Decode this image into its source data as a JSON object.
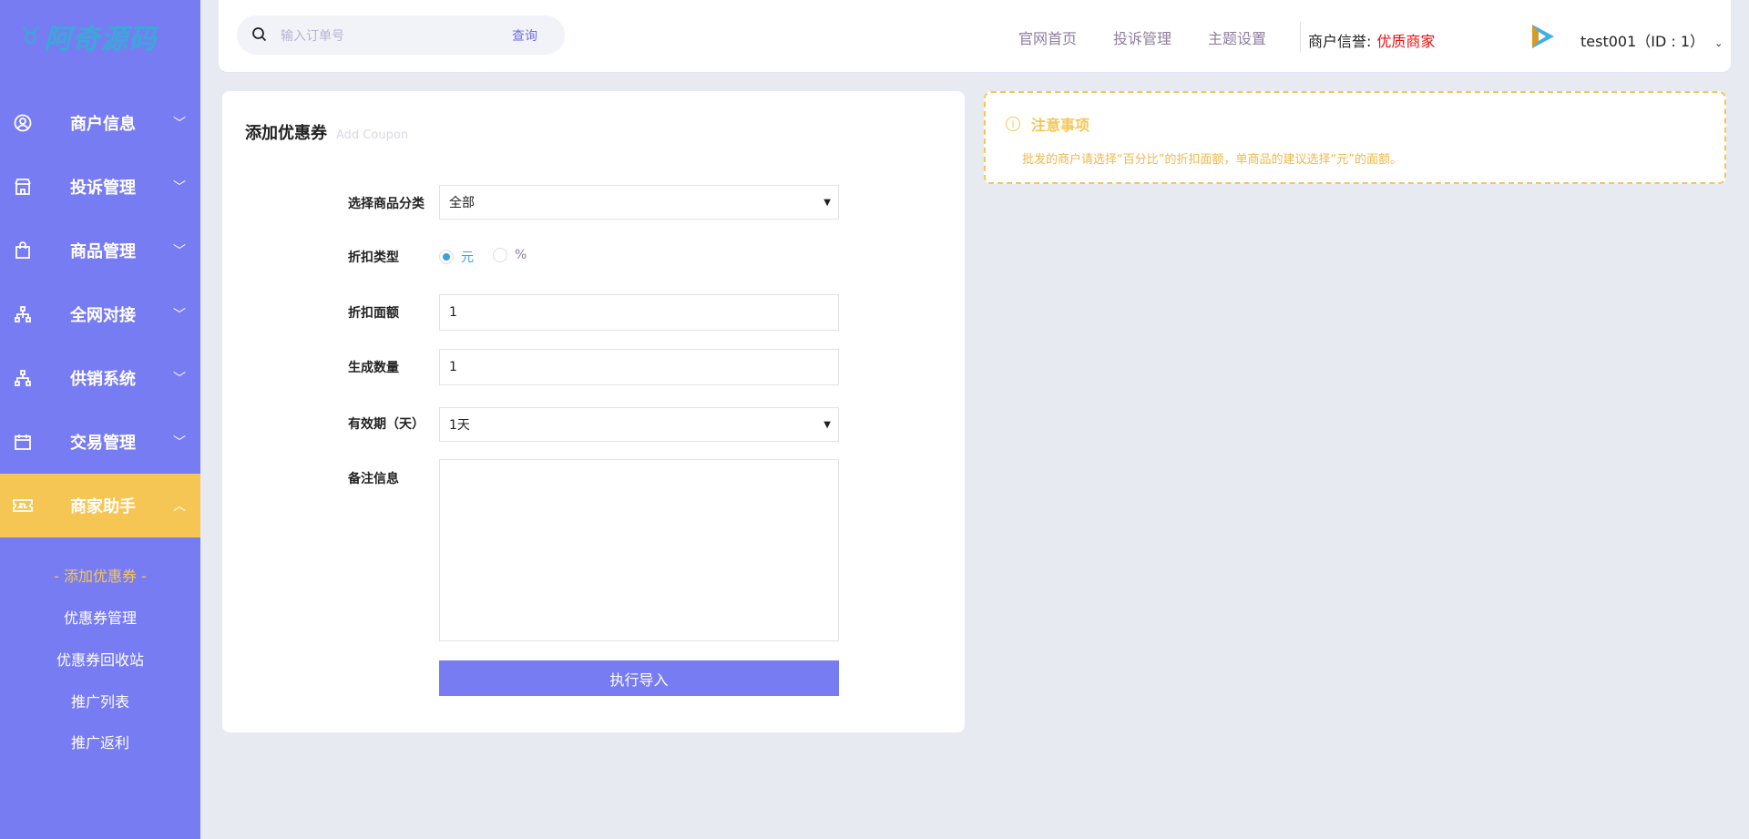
{
  "sidebar": {
    "logo": "阿奇源码",
    "items": [
      {
        "label": "商户信息",
        "icon": "user-circle-icon"
      },
      {
        "label": "投诉管理",
        "icon": "store-icon"
      },
      {
        "label": "商品管理",
        "icon": "bag-icon"
      },
      {
        "label": "全网对接",
        "icon": "sitemap-icon"
      },
      {
        "label": "供销系统",
        "icon": "sitemap-icon"
      },
      {
        "label": "交易管理",
        "icon": "calendar-icon"
      },
      {
        "label": "商家助手",
        "icon": "ticket-icon",
        "active": true
      }
    ],
    "subitems": [
      {
        "label": "-  添加优惠券  -",
        "active": true
      },
      {
        "label": "优惠券管理"
      },
      {
        "label": "优惠券回收站"
      },
      {
        "label": "推广列表"
      },
      {
        "label": "推广返利"
      }
    ]
  },
  "header": {
    "search_placeholder": "输入订单号",
    "search_button": "查询",
    "nav": [
      "官网首页",
      "投诉管理",
      "主题设置"
    ],
    "credit_label": "商户信誉:",
    "credit_value": "优质商家",
    "user": "test001（ID : 1）"
  },
  "form": {
    "title": "添加优惠券",
    "subtitle": "Add Coupon",
    "category_label": "选择商品分类",
    "category_value": "全部",
    "type_label": "折扣类型",
    "type_options": [
      "元",
      "%"
    ],
    "type_selected": "元",
    "amount_label": "折扣面额",
    "amount_value": "1",
    "count_label": "生成数量",
    "count_value": "1",
    "expiry_label": "有效期（天）",
    "expiry_value": "1天",
    "remark_label": "备注信息",
    "remark_value": "",
    "submit": "执行导入"
  },
  "notice": {
    "title": "注意事项",
    "body": "批发的商户请选择“百分比”的折扣面额，单商品的建议选择“元”的面额。"
  },
  "colors": {
    "sidebar": "#787cf2",
    "accent": "#f6c654",
    "danger": "#f00b0b",
    "radio": "#3aa1dc"
  }
}
